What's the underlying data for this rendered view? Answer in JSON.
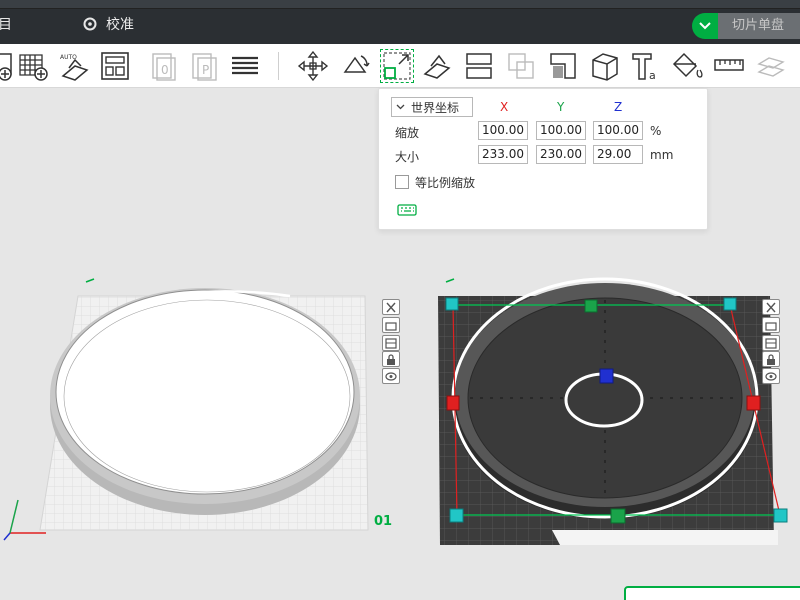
{
  "topbar": {
    "menu_partial": "目",
    "calibration_label": "校准",
    "slice_button_label": "切片单盘",
    "colors": {
      "bar": "#2b2f33",
      "accent": "#00ae42"
    }
  },
  "toolbar": {
    "tools": [
      "add-plate-icon",
      "arrange-grid-icon",
      "auto-orient-icon",
      "layout-icon",
      "plate-o-icon",
      "plate-p-icon",
      "layers-icon",
      "move-icon",
      "rotate-icon",
      "scale-icon",
      "lay-on-face-icon",
      "split-icon",
      "cut-icon",
      "boolean-icon",
      "support-paint-icon",
      "cube-icon",
      "text-icon",
      "paint-bucket-icon",
      "measure-icon",
      "assembly-icon"
    ],
    "active_tool": "scale-icon"
  },
  "scale_panel": {
    "coordinate_system": "世界坐标",
    "axes": {
      "x": "X",
      "y": "Y",
      "z": "Z"
    },
    "axis_colors": {
      "x": "#e02020",
      "y": "#1aa34a",
      "z": "#2030d0"
    },
    "scale": {
      "label": "缩放",
      "x": "100.00",
      "y": "100.00",
      "z": "100.00",
      "unit": "%"
    },
    "size": {
      "label": "大小",
      "x": "233.00",
      "y": "230.00",
      "z": "29.00",
      "unit": "mm"
    },
    "uniform_scale": {
      "label": "等比例缩放",
      "checked": false
    }
  },
  "plates": {
    "left_plate_number": "01"
  }
}
